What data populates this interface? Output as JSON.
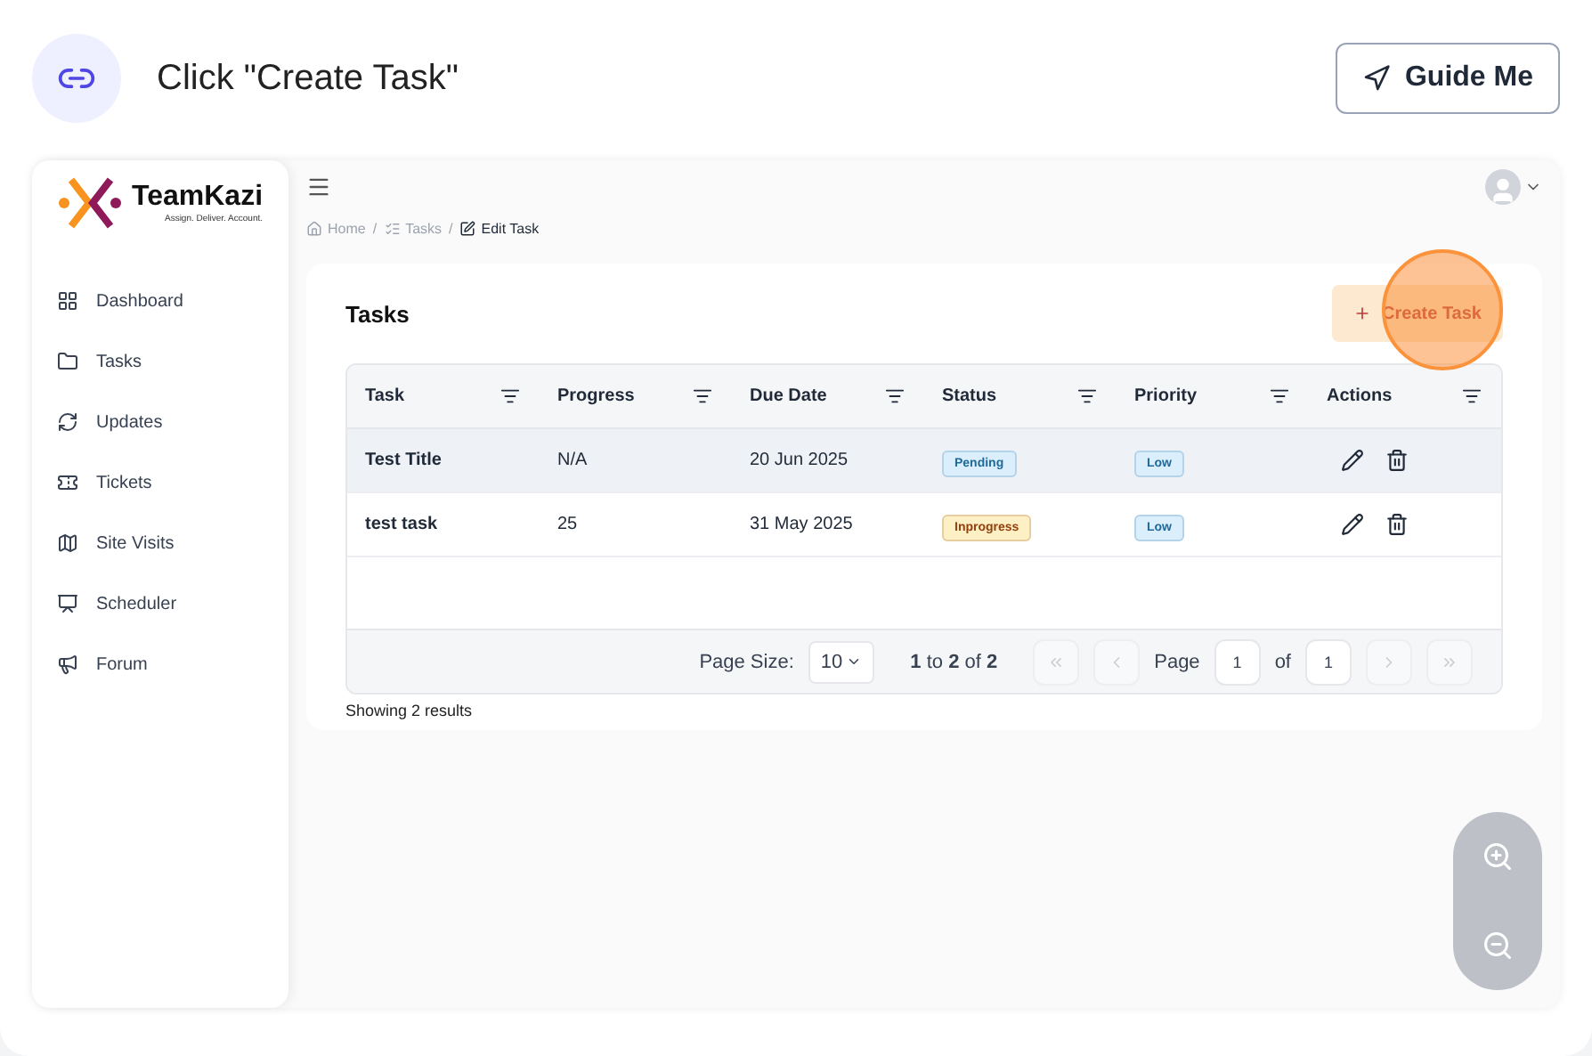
{
  "step": {
    "title": "Click \"Create Task\"",
    "guide_button": "Guide Me"
  },
  "app": {
    "logo": {
      "name": "TeamKazi",
      "tagline": "Assign. Deliver. Account."
    },
    "sidebar": {
      "items": [
        {
          "label": "Dashboard"
        },
        {
          "label": "Tasks"
        },
        {
          "label": "Updates"
        },
        {
          "label": "Tickets"
        },
        {
          "label": "Site Visits"
        },
        {
          "label": "Scheduler"
        },
        {
          "label": "Forum"
        }
      ]
    },
    "breadcrumb": [
      {
        "label": "Home",
        "current": false
      },
      {
        "separator": "/",
        "label": "Tasks",
        "current": false
      },
      {
        "separator": "/",
        "label": "Edit Task",
        "current": true
      }
    ],
    "card": {
      "title": "Tasks",
      "create_button": "Create Task",
      "highlighted": true
    },
    "table": {
      "columns": [
        "Task",
        "Progress",
        "Due Date",
        "Status",
        "Priority",
        "Actions"
      ],
      "rows": [
        {
          "task": "Test Title",
          "progress": "N/A",
          "due": "20 Jun 2025",
          "status": {
            "label": "Pending",
            "kind": "pending"
          },
          "priority": {
            "label": "Low",
            "kind": "low"
          },
          "hovered": true
        },
        {
          "task": "test task",
          "progress": "25",
          "due": "31 May 2025",
          "status": {
            "label": "Inprogress",
            "kind": "inprogress"
          },
          "priority": {
            "label": "Low",
            "kind": "low"
          },
          "hovered": false
        }
      ]
    },
    "pagination": {
      "page_size_label": "Page Size:",
      "page_size": "10",
      "range": "**1** to **2** of **2**",
      "page_label": "Page",
      "page": "1",
      "of_label": "of",
      "total_pages": "1"
    },
    "footer": "Showing 2 results"
  }
}
